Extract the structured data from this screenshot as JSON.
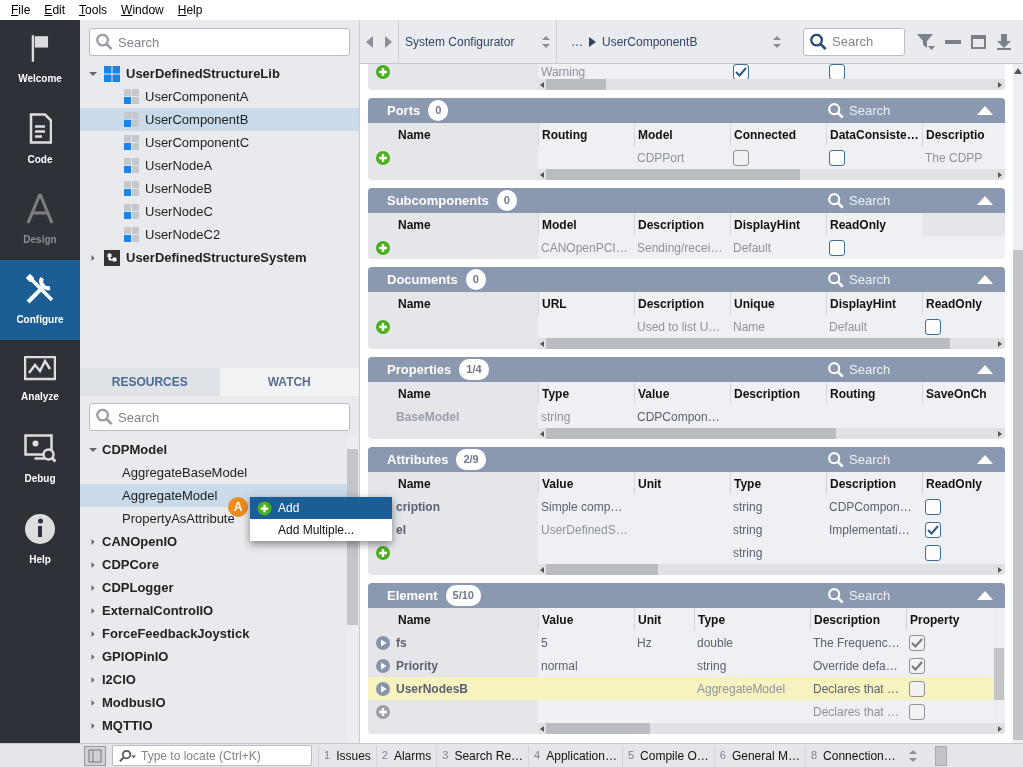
{
  "menu_bar": [
    "File",
    "Edit",
    "Tools",
    "Window",
    "Help"
  ],
  "rail": [
    {
      "label": "Welcome",
      "selected": false,
      "disabled": false
    },
    {
      "label": "Code",
      "selected": false,
      "disabled": false
    },
    {
      "label": "Design",
      "selected": false,
      "disabled": true
    },
    {
      "label": "Configure",
      "selected": true,
      "disabled": false
    },
    {
      "label": "Analyze",
      "selected": false,
      "disabled": false
    },
    {
      "label": "Debug",
      "selected": false,
      "disabled": false
    },
    {
      "label": "Help",
      "selected": false,
      "disabled": false
    }
  ],
  "project_search": {
    "placeholder": "Search"
  },
  "project_tree": [
    {
      "label": "UserDefinedStructureLib",
      "kind": "library",
      "expanded": true,
      "selected": false,
      "children": [
        {
          "label": "UserComponentA",
          "kind": "component",
          "selected": false
        },
        {
          "label": "UserComponentB",
          "kind": "component",
          "selected": true
        },
        {
          "label": "UserComponentC",
          "kind": "component",
          "selected": false
        },
        {
          "label": "UserNodeA",
          "kind": "component",
          "selected": false
        },
        {
          "label": "UserNodeB",
          "kind": "component",
          "selected": false
        },
        {
          "label": "UserNodeC",
          "kind": "component",
          "selected": false
        },
        {
          "label": "UserNodeC2",
          "kind": "component",
          "selected": false
        }
      ]
    },
    {
      "label": "UserDefinedStructureSystem",
      "kind": "system",
      "expanded": false,
      "selected": false
    }
  ],
  "bottom_tabs": [
    {
      "label": "RESOURCES",
      "selected": true
    },
    {
      "label": "WATCH",
      "selected": false
    }
  ],
  "resource_search": {
    "placeholder": "Search"
  },
  "resource_tree": [
    {
      "label": "CDPModel",
      "expanded": true,
      "selected": false,
      "children": [
        {
          "label": "AggregateBaseModel",
          "selected": false
        },
        {
          "label": "AggregateModel",
          "selected": true
        },
        {
          "label": "PropertyAsAttribute",
          "selected": false
        }
      ]
    },
    {
      "label": "CANOpenIO",
      "expanded": false,
      "selected": false
    },
    {
      "label": "CDPCore",
      "expanded": false,
      "selected": false
    },
    {
      "label": "CDPLogger",
      "expanded": false,
      "selected": false
    },
    {
      "label": "ExternalControlIO",
      "expanded": false,
      "selected": false
    },
    {
      "label": "ForceFeedbackJoystick",
      "expanded": false,
      "selected": false
    },
    {
      "label": "GPIOPinIO",
      "expanded": false,
      "selected": false
    },
    {
      "label": "I2CIO",
      "expanded": false,
      "selected": false
    },
    {
      "label": "ModbusIO",
      "expanded": false,
      "selected": false
    },
    {
      "label": "MQTTIO",
      "expanded": false,
      "selected": false
    }
  ],
  "context_menu": {
    "badge": "A",
    "items": [
      {
        "label": "Add",
        "kind": "add",
        "selected": true
      },
      {
        "label": "Add Multiple...",
        "kind": "plain",
        "selected": false
      }
    ]
  },
  "header": {
    "breadcrumb_1": "System Configurator",
    "ellipsis": "…",
    "breadcrumb_2": "UserComponentB",
    "search": {
      "placeholder": "Search"
    }
  },
  "scrolled_section": {
    "rows": [
      {
        "highlighted": false,
        "cells": [
          {
            "kind": "add"
          },
          {
            "kind": "default",
            "text": "Warning"
          },
          {
            "kind": "blank"
          },
          {
            "kind": "check",
            "checked": true,
            "disabled": false
          },
          {
            "kind": "check",
            "checked": false,
            "disabled": false
          }
        ]
      }
    ]
  },
  "sections": [
    {
      "title": "Ports",
      "count": "0",
      "search_placeholder": "Search",
      "expanded": true,
      "h_scrollbar": true,
      "columns": [
        "Name",
        "Routing",
        "Model",
        "Connected",
        "DataConsiste…",
        "Descriptio"
      ],
      "rows": [
        {
          "highlighted": false,
          "cells": [
            {
              "kind": "add"
            },
            {
              "kind": "blank"
            },
            {
              "kind": "default",
              "text": "CDPPort"
            },
            {
              "kind": "check",
              "checked": false,
              "disabled": true
            },
            {
              "kind": "check",
              "checked": false,
              "disabled": false
            },
            {
              "kind": "default",
              "text": "The CDPP"
            }
          ]
        }
      ]
    },
    {
      "title": "Subcomponents",
      "count": "0",
      "search_placeholder": "Search",
      "expanded": true,
      "h_scrollbar": false,
      "columns": [
        "Name",
        "Model",
        "Description",
        "DisplayHint",
        "ReadOnly"
      ],
      "rows": [
        {
          "highlighted": false,
          "cells": [
            {
              "kind": "add"
            },
            {
              "kind": "default",
              "text": "CANOpenPCI…"
            },
            {
              "kind": "default",
              "text": "Sending/recei…"
            },
            {
              "kind": "default",
              "text": "Default"
            },
            {
              "kind": "check",
              "checked": false,
              "disabled": false
            }
          ]
        }
      ]
    },
    {
      "title": "Documents",
      "count": "0",
      "search_placeholder": "Search",
      "expanded": true,
      "h_scrollbar": true,
      "columns": [
        "Name",
        "URL",
        "Description",
        "Unique",
        "DisplayHint",
        "ReadOnly"
      ],
      "rows": [
        {
          "highlighted": false,
          "cells": [
            {
              "kind": "add"
            },
            {
              "kind": "blank"
            },
            {
              "kind": "default",
              "text": "Used to list U…"
            },
            {
              "kind": "default",
              "text": "Name"
            },
            {
              "kind": "default",
              "text": "Default"
            },
            {
              "kind": "check",
              "checked": false,
              "disabled": false
            }
          ]
        }
      ]
    },
    {
      "title": "Properties",
      "count": "1/4",
      "search_placeholder": "Search",
      "expanded": true,
      "h_scrollbar": true,
      "columns": [
        "Name",
        "Type",
        "Value",
        "Description",
        "Routing",
        "SaveOnCh"
      ],
      "rows": [
        {
          "highlighted": false,
          "cells": [
            {
              "kind": "inherited",
              "text": "BaseModel"
            },
            {
              "kind": "default",
              "text": "string"
            },
            {
              "kind": "text",
              "text": "CDPCompon…"
            },
            {
              "kind": "blank"
            },
            {
              "kind": "blank"
            },
            {
              "kind": "blank"
            }
          ]
        }
      ]
    },
    {
      "title": "Attributes",
      "count": "2/9",
      "search_placeholder": "Search",
      "expanded": true,
      "h_scrollbar": true,
      "columns": [
        "Name",
        "Value",
        "Unit",
        "Type",
        "Description",
        "ReadOnly"
      ],
      "rows": [
        {
          "highlighted": false,
          "cells": [
            {
              "kind": "attribute",
              "text": "cription"
            },
            {
              "kind": "text",
              "text": "Simple comp…"
            },
            {
              "kind": "blank"
            },
            {
              "kind": "text",
              "text": "string"
            },
            {
              "kind": "text",
              "text": "CDPCompon…"
            },
            {
              "kind": "check",
              "checked": false,
              "disabled": false
            }
          ]
        },
        {
          "highlighted": false,
          "cells": [
            {
              "kind": "attribute",
              "text": "el"
            },
            {
              "kind": "default",
              "text": "UserDefinedS…"
            },
            {
              "kind": "blank"
            },
            {
              "kind": "text",
              "text": "string"
            },
            {
              "kind": "text",
              "text": "Implementati…"
            },
            {
              "kind": "check",
              "checked": true,
              "disabled": false
            }
          ]
        },
        {
          "highlighted": false,
          "cells": [
            {
              "kind": "add"
            },
            {
              "kind": "blank"
            },
            {
              "kind": "blank"
            },
            {
              "kind": "text",
              "text": "string"
            },
            {
              "kind": "blank"
            },
            {
              "kind": "check",
              "checked": false,
              "disabled": false
            }
          ]
        }
      ]
    },
    {
      "title": "Element",
      "count": "5/10",
      "search_placeholder": "Search",
      "expanded": true,
      "h_scrollbar": true,
      "columns": [
        "Name",
        "Value",
        "Unit",
        "Type",
        "Description",
        "Property"
      ],
      "rows": [
        {
          "highlighted": false,
          "cells": [
            {
              "kind": "element",
              "text": "fs"
            },
            {
              "kind": "text",
              "text": "5"
            },
            {
              "kind": "text",
              "text": "Hz"
            },
            {
              "kind": "text",
              "text": "double"
            },
            {
              "kind": "text",
              "text": "The Frequenc…"
            },
            {
              "kind": "check",
              "checked": true,
              "disabled": true
            }
          ]
        },
        {
          "highlighted": false,
          "cells": [
            {
              "kind": "element",
              "text": "Priority"
            },
            {
              "kind": "text",
              "text": "normal"
            },
            {
              "kind": "blank"
            },
            {
              "kind": "text",
              "text": "string"
            },
            {
              "kind": "text",
              "text": "Override defa…"
            },
            {
              "kind": "check",
              "checked": true,
              "disabled": true
            }
          ]
        },
        {
          "highlighted": true,
          "cells": [
            {
              "kind": "element",
              "text": "UserNodesB"
            },
            {
              "kind": "blank"
            },
            {
              "kind": "blank"
            },
            {
              "kind": "default",
              "text": "AggregateModel"
            },
            {
              "kind": "text",
              "text": "Declares that …"
            },
            {
              "kind": "check",
              "checked": false,
              "disabled": true
            }
          ]
        },
        {
          "highlighted": false,
          "cells": [
            {
              "kind": "add_disabled"
            },
            {
              "kind": "blank"
            },
            {
              "kind": "blank"
            },
            {
              "kind": "blank"
            },
            {
              "kind": "default",
              "text": "Declares that …"
            },
            {
              "kind": "check",
              "checked": false,
              "disabled": true
            }
          ]
        }
      ]
    }
  ],
  "status_bar": {
    "locate": {
      "placeholder": "Type to locate (Ctrl+K)"
    },
    "tabs": [
      {
        "number": "1",
        "label": "Issues"
      },
      {
        "number": "2",
        "label": "Alarms"
      },
      {
        "number": "3",
        "label": "Search Re…"
      },
      {
        "number": "4",
        "label": "Application…"
      },
      {
        "number": "5",
        "label": "Compile O…"
      },
      {
        "number": "6",
        "label": "General M…"
      },
      {
        "number": "8",
        "label": "Connection…"
      }
    ]
  }
}
